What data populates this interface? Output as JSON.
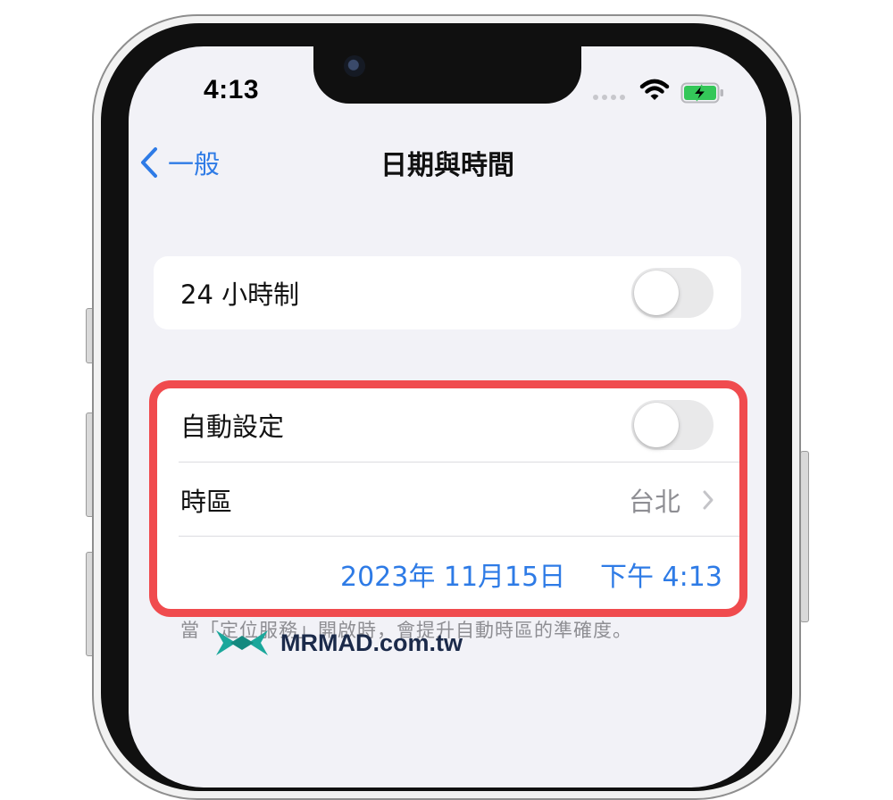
{
  "status_bar": {
    "time": "4:13"
  },
  "nav": {
    "back_label": "一般",
    "title": "日期與時間"
  },
  "clock_group": {
    "label_24h": "24 小時制",
    "toggle_24h_on": false
  },
  "auto_group": {
    "auto_set_label": "自動設定",
    "auto_set_on": false,
    "timezone_label": "時區",
    "timezone_value": "台北",
    "date_value": "2023年 11月15日",
    "time_value": "下午 4:13"
  },
  "footnote": "當「定位服務」開啟時，會提升自動時區的準確度。",
  "watermark": {
    "brand": "MRMAD",
    "domain": ".com.tw"
  },
  "colors": {
    "accent": "#2e7be6",
    "highlight": "#f04b4e",
    "battery": "#34c759"
  }
}
